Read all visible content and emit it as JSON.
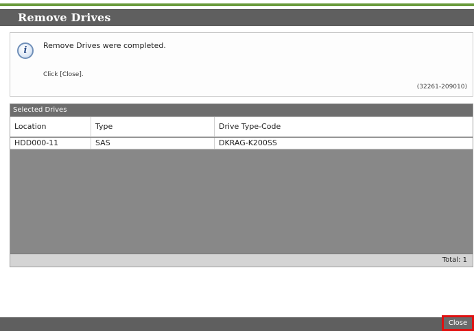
{
  "dialog": {
    "title": "Remove Drives"
  },
  "message": {
    "icon": "info-icon",
    "main_text": "Remove Drives were completed.",
    "sub_text": "Click [Close].",
    "code": "(32261-209010)"
  },
  "selected_drives": {
    "header": "Selected Drives",
    "columns": [
      "Location",
      "Type",
      "Drive Type-Code"
    ],
    "rows": [
      [
        "HDD000-11",
        "SAS",
        "DKRAG-K200SS"
      ]
    ],
    "total_label": "Total:  1"
  },
  "footer": {
    "close_label": "Close"
  },
  "colors": {
    "title_bar": "#5f5f5f",
    "accent_green": "#6a9b3c",
    "close_highlight": "#e01010"
  }
}
